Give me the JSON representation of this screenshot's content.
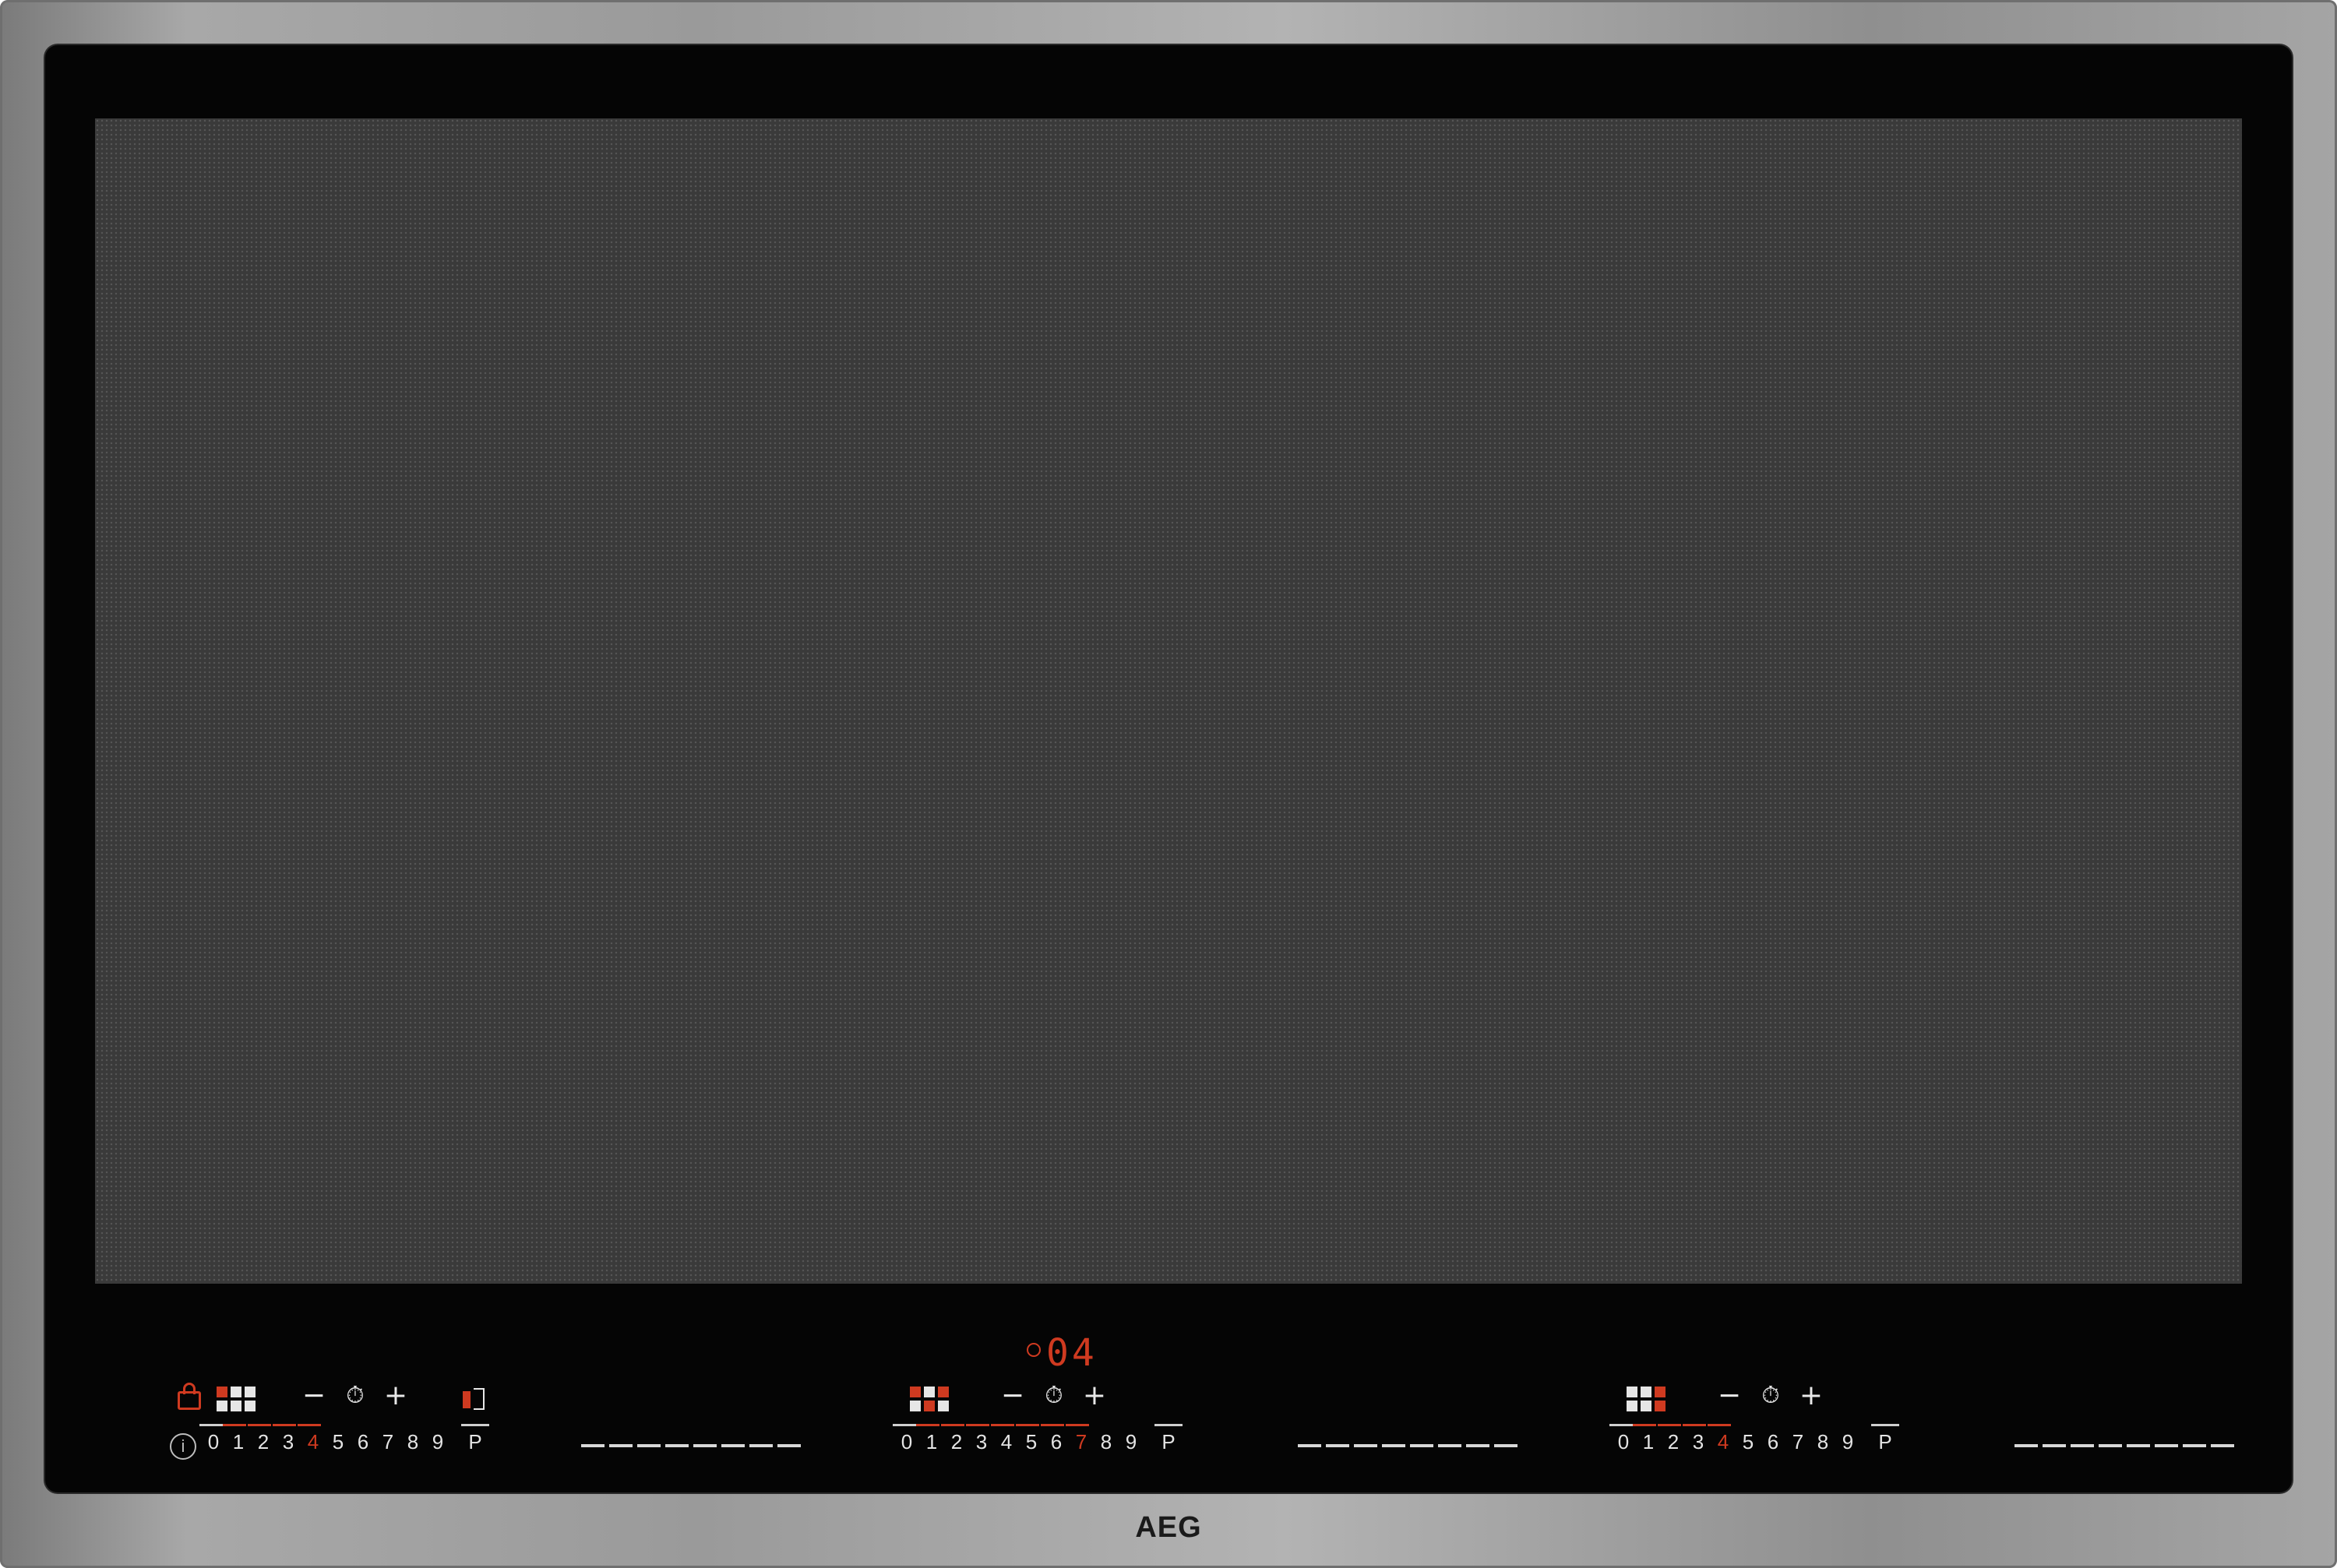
{
  "brand": "AEG",
  "colors": {
    "accent_red": "#cf3a20",
    "glass": "#050505",
    "frame": "#9a9a9a",
    "cooking_zone": "#3a3a3a"
  },
  "icons": {
    "lock": "lock-icon",
    "info": "info-icon",
    "bridge": "bridge-icon",
    "timer": "clock-icon"
  },
  "zones": [
    {
      "name": "left",
      "minus": "−",
      "plus": "+",
      "timer_icon": "⏱",
      "scale": [
        "0",
        "1",
        "2",
        "3",
        "4",
        "5",
        "6",
        "7",
        "8",
        "9",
        "P"
      ],
      "active_level": "4",
      "grid_pattern": [
        1,
        0,
        0,
        0,
        0,
        0
      ]
    },
    {
      "name": "middle",
      "minus": "−",
      "plus": "+",
      "timer_icon": "⏱",
      "timer_display": "04",
      "scale": [
        "0",
        "1",
        "2",
        "3",
        "4",
        "5",
        "6",
        "7",
        "8",
        "9",
        "P"
      ],
      "active_level": "7",
      "grid_pattern": [
        1,
        0,
        1,
        0,
        1,
        0
      ]
    },
    {
      "name": "right",
      "minus": "−",
      "plus": "+",
      "timer_icon": "⏱",
      "scale": [
        "0",
        "1",
        "2",
        "3",
        "4",
        "5",
        "6",
        "7",
        "8",
        "9",
        "P"
      ],
      "active_level": "4",
      "grid_pattern": [
        0,
        0,
        1,
        0,
        0,
        1
      ]
    }
  ]
}
